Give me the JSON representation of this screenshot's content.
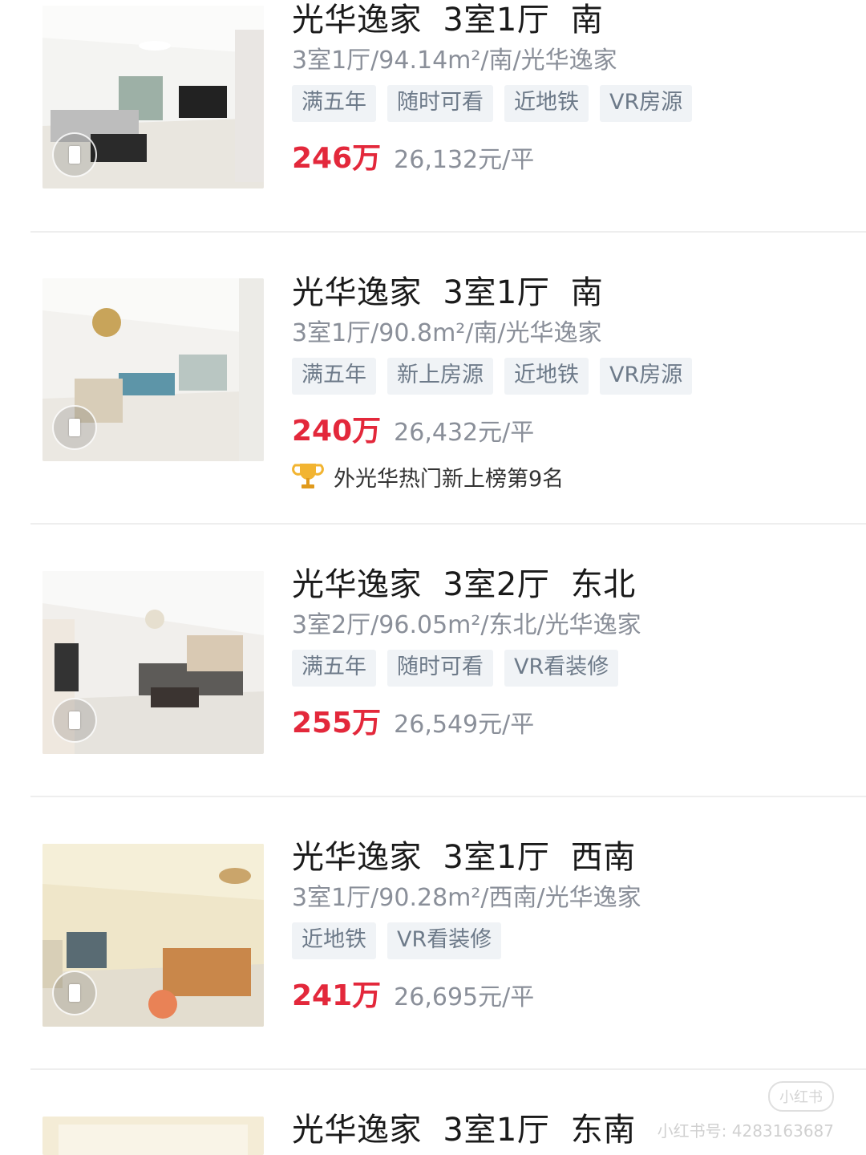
{
  "listings": [
    {
      "title": "光华逸家  3室1厅  南",
      "subtitle": "3室1厅/94.14m²/南/光华逸家",
      "tags": [
        "满五年",
        "随时可看",
        "近地铁",
        "VR房源"
      ],
      "price": "246万",
      "unit_price": "26,132元/平",
      "rank": ""
    },
    {
      "title": "光华逸家  3室1厅  南",
      "subtitle": "3室1厅/90.8m²/南/光华逸家",
      "tags": [
        "满五年",
        "新上房源",
        "近地铁",
        "VR房源"
      ],
      "price": "240万",
      "unit_price": "26,432元/平",
      "rank": "外光华热门新上榜第9名"
    },
    {
      "title": "光华逸家  3室2厅  东北",
      "subtitle": "3室2厅/96.05m²/东北/光华逸家",
      "tags": [
        "满五年",
        "随时可看",
        "VR看装修"
      ],
      "price": "255万",
      "unit_price": "26,549元/平",
      "rank": ""
    },
    {
      "title": "光华逸家  3室1厅  西南",
      "subtitle": "3室1厅/90.28m²/西南/光华逸家",
      "tags": [
        "近地铁",
        "VR看装修"
      ],
      "price": "241万",
      "unit_price": "26,695元/平",
      "rank": ""
    },
    {
      "title": "光华逸家  3室1厅  东南",
      "subtitle": "",
      "tags": [],
      "price": "",
      "unit_price": "",
      "rank": ""
    }
  ],
  "watermark": {
    "logo": "小红书",
    "id_text": "小红书号: 4283163687"
  },
  "colors": {
    "price": "#e3283b",
    "tag_bg": "#f0f3f6",
    "tag_text": "#6d7a89",
    "subtitle": "#8a8f99"
  },
  "icons": [
    "vr-badge-icon",
    "trophy-icon"
  ]
}
